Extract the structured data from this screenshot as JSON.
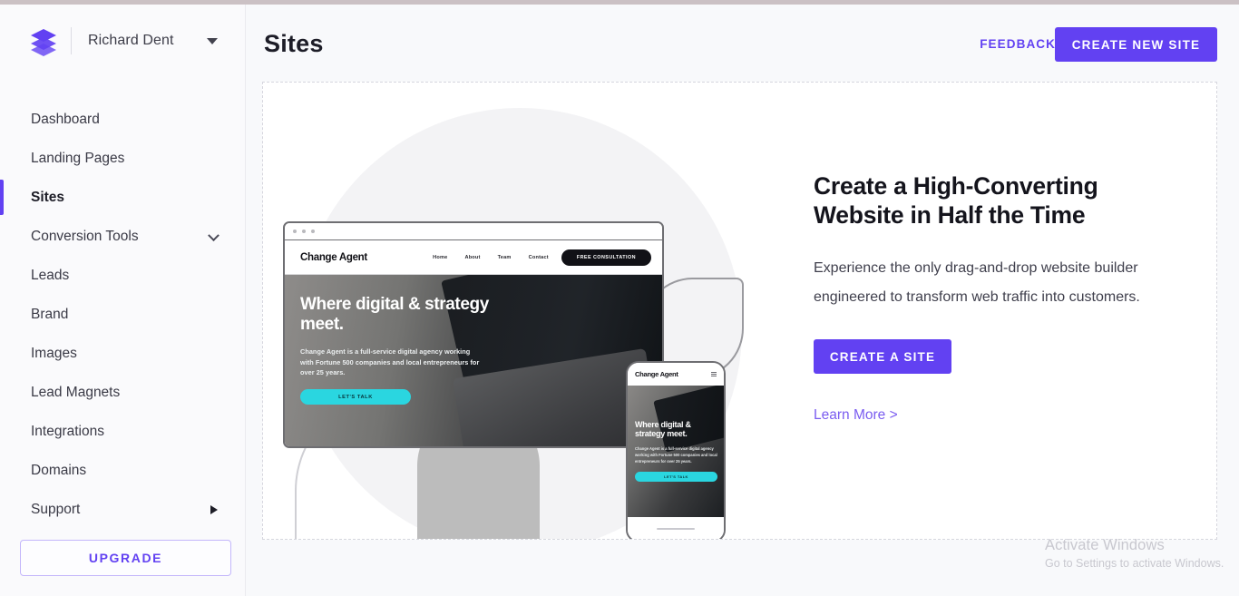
{
  "app": {
    "logo_icon": "layers-icon",
    "account_name": "Richard Dent",
    "account_caret_icon": "caret-down-icon"
  },
  "header": {
    "page_title": "Sites",
    "feedback_label": "FEEDBACK",
    "create_new_site_label": "CREATE NEW SITE"
  },
  "sidebar": {
    "items": [
      {
        "label": "Dashboard",
        "active": false,
        "trailing_icon": ""
      },
      {
        "label": "Landing Pages",
        "active": false,
        "trailing_icon": ""
      },
      {
        "label": "Sites",
        "active": true,
        "trailing_icon": ""
      },
      {
        "label": "Conversion Tools",
        "active": false,
        "trailing_icon": "chevron-down-icon"
      },
      {
        "label": "Leads",
        "active": false,
        "trailing_icon": ""
      },
      {
        "label": "Brand",
        "active": false,
        "trailing_icon": ""
      },
      {
        "label": "Images",
        "active": false,
        "trailing_icon": ""
      },
      {
        "label": "Lead Magnets",
        "active": false,
        "trailing_icon": ""
      },
      {
        "label": "Integrations",
        "active": false,
        "trailing_icon": ""
      },
      {
        "label": "Domains",
        "active": false,
        "trailing_icon": ""
      },
      {
        "label": "Support",
        "active": false,
        "trailing_icon": "arrow-right-icon"
      }
    ],
    "upgrade_label": "UPGRADE"
  },
  "promo": {
    "heading": "Create a High-Converting Website in Half the Time",
    "body": "Experience the only drag-and-drop website builder engineered to transform web traffic into customers.",
    "cta_label": "CREATE A SITE",
    "learn_more_label": "Learn More >"
  },
  "mockup": {
    "desktop": {
      "brand": "Change Agent",
      "nav_links": [
        "Home",
        "About",
        "Team",
        "Contact"
      ],
      "nav_cta": "FREE CONSULTATION",
      "hero_heading": "Where digital & strategy meet.",
      "hero_body": "Change Agent is a full-service digital agency working with Fortune 500 companies and local entrepreneurs for over 25 years.",
      "hero_cta": "LET'S TALK"
    },
    "phone": {
      "brand": "Change Agent",
      "menu_icon": "hamburger-icon",
      "hero_heading": "Where digital & strategy meet.",
      "hero_body": "Change Agent is a full-service digital agency working with Fortune 500 companies and local entrepreneurs for over 25 years.",
      "hero_cta": "LET'S TALK"
    }
  },
  "watermark": {
    "title": "Activate Windows",
    "subtitle": "Go to Settings to activate Windows."
  },
  "colors": {
    "accent_purple": "#6241f2",
    "link_purple": "#7a5cf0",
    "cyan": "#2ad6e0",
    "page_bg": "#f8f9fb"
  }
}
